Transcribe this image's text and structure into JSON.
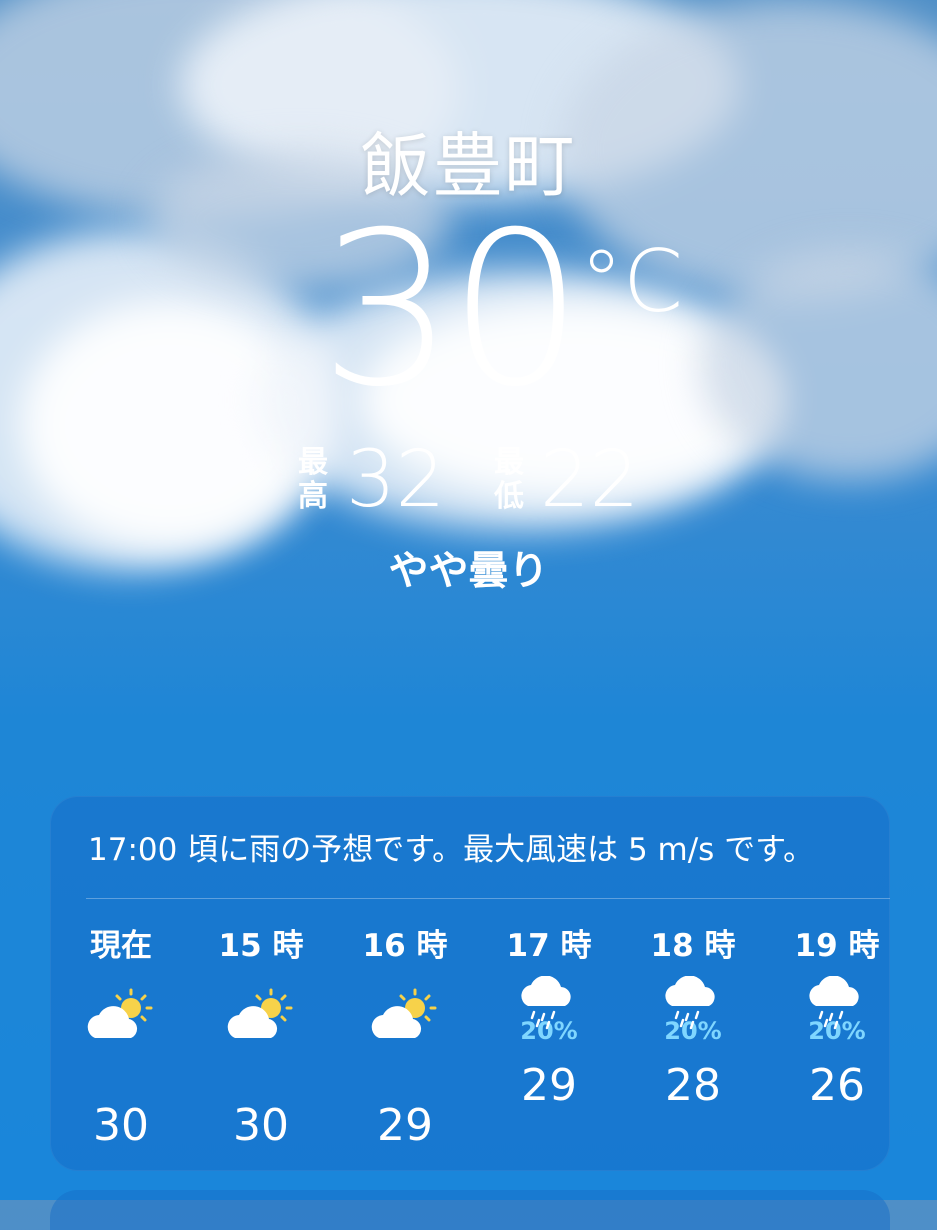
{
  "location": {
    "name": "飯豊町"
  },
  "current": {
    "temperature": "30",
    "unit": "°C",
    "high_label": "最高",
    "high": "32",
    "low_label": "最低",
    "low": "22",
    "condition": "やや曇り"
  },
  "forecast": {
    "summary": "17:00 頃に雨の予想です。最大風速は 5 m/s です。",
    "hours": [
      {
        "label": "現在",
        "icon": "partly-cloudy-icon",
        "precip": "",
        "temp": "30"
      },
      {
        "label": "15 時",
        "icon": "partly-cloudy-icon",
        "precip": "",
        "temp": "30"
      },
      {
        "label": "16 時",
        "icon": "partly-cloudy-icon",
        "precip": "",
        "temp": "29"
      },
      {
        "label": "17 時",
        "icon": "rain-cloud-icon",
        "precip": "20%",
        "temp": "29"
      },
      {
        "label": "18 時",
        "icon": "rain-cloud-icon",
        "precip": "20%",
        "temp": "28"
      },
      {
        "label": "19 時",
        "icon": "rain-cloud-icon",
        "precip": "20%",
        "temp": "26"
      }
    ]
  },
  "colors": {
    "sky": "#1e86d6",
    "precip": "#7fd6ff",
    "sun": "#f7d24a"
  }
}
